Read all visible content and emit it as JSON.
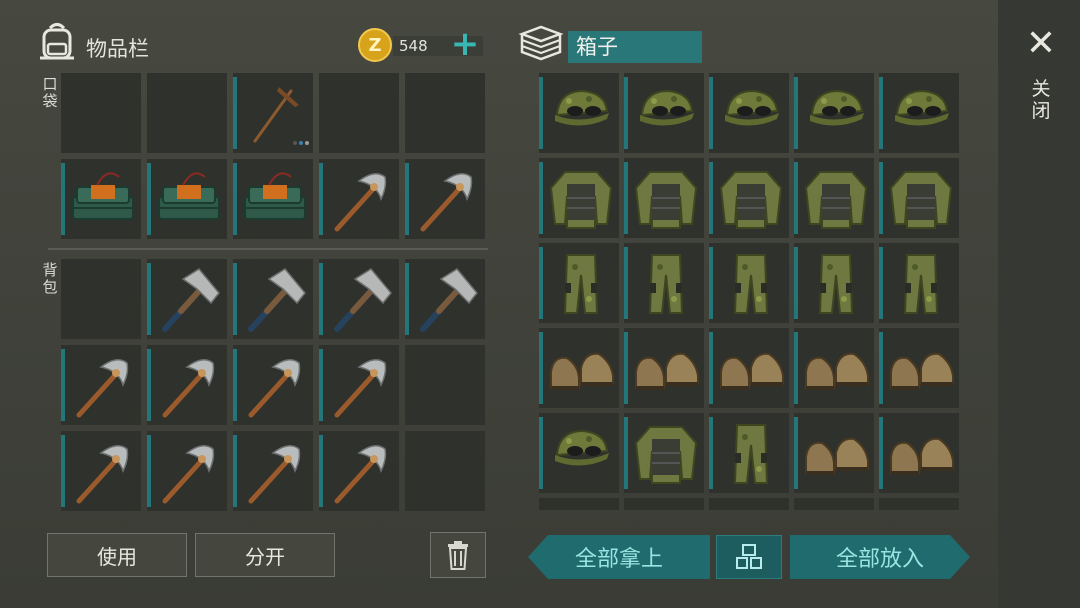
{
  "inventory": {
    "title": "物品栏",
    "coins": "548",
    "coin_symbol": "Z",
    "plus": "+",
    "pocket_label": "口袋",
    "backpack_label": "背包"
  },
  "box": {
    "name": "箱子"
  },
  "close_label": "关闭",
  "close_symbol": "✕",
  "buttons": {
    "use": "使用",
    "split": "分开",
    "take_all": "全部拿上",
    "put_all": "全部放入",
    "sort_symbol": "品"
  },
  "pocket_slots": [
    "",
    "",
    "pickaxe_small",
    "",
    "",
    "c4",
    "c4",
    "c4",
    "pickaxe",
    "pickaxe"
  ],
  "backpack_slots": [
    "",
    "hammer",
    "hammer",
    "hammer",
    "hammer",
    "pickaxe",
    "pickaxe",
    "pickaxe",
    "pickaxe",
    "",
    "pickaxe",
    "pickaxe",
    "pickaxe",
    "pickaxe",
    ""
  ],
  "box_slots": [
    "cap",
    "cap",
    "cap",
    "cap",
    "cap",
    "jacket",
    "jacket",
    "jacket",
    "jacket",
    "jacket",
    "pants",
    "pants",
    "pants",
    "pants",
    "pants",
    "boots",
    "boots",
    "boots",
    "boots",
    "boots",
    "cap",
    "jacket",
    "pants",
    "boots",
    "boots"
  ],
  "colors": {
    "accent": "#23767a",
    "slot": "#2f312c",
    "teal_button": "#1f6b6d"
  }
}
